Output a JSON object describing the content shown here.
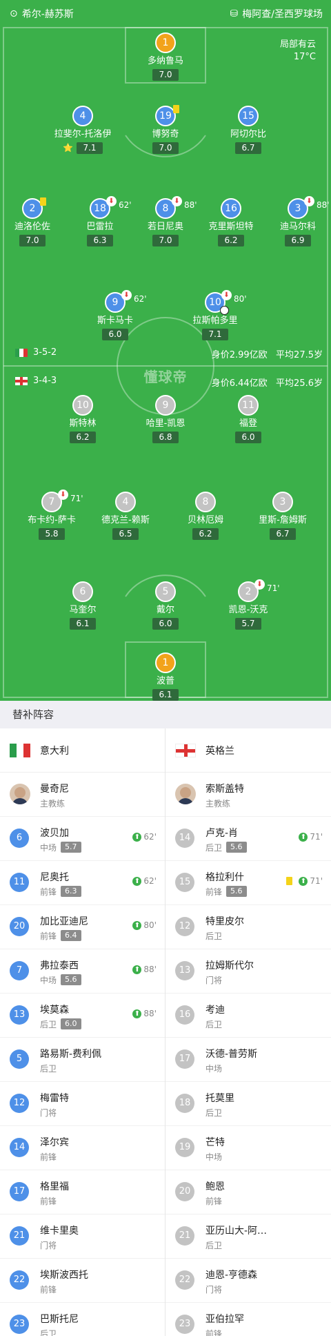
{
  "header": {
    "referee": "希尔-赫苏斯",
    "venue": "梅阿查/圣西罗球场"
  },
  "weather": {
    "condition": "局部有云",
    "temp": "17°C"
  },
  "logo": "懂球帝",
  "italy": {
    "formation": "3-5-2",
    "value": "身价2.99亿欧",
    "age": "平均27.5岁"
  },
  "england": {
    "formation": "3-4-3",
    "value": "身价6.44亿欧",
    "age": "平均25.6岁"
  },
  "pitch_players": [
    {
      "num": "1",
      "name": "多纳鲁马",
      "rating": "7.0",
      "team": "gk"
    },
    {
      "num": "4",
      "name": "拉斐尔-托洛伊",
      "rating": "7.1",
      "team": "ita",
      "star": "⭐"
    },
    {
      "num": "19",
      "name": "博努奇",
      "rating": "7.0",
      "team": "ita"
    },
    {
      "num": "15",
      "name": "阿切尔比",
      "rating": "6.7",
      "team": "ita"
    },
    {
      "num": "2",
      "name": "迪洛伦佐",
      "rating": "7.0",
      "team": "ita"
    },
    {
      "num": "18",
      "name": "巴雷拉",
      "rating": "6.3",
      "team": "ita",
      "sub": "62'"
    },
    {
      "num": "8",
      "name": "若日尼奥",
      "rating": "7.0",
      "team": "ita",
      "sub": "88'"
    },
    {
      "num": "16",
      "name": "克里斯坦特",
      "rating": "6.2",
      "team": "ita"
    },
    {
      "num": "3",
      "name": "迪马尔科",
      "rating": "6.9",
      "team": "ita",
      "sub": "88'"
    },
    {
      "num": "9",
      "name": "斯卡马卡",
      "rating": "6.0",
      "team": "ita",
      "sub": "62'"
    },
    {
      "num": "10",
      "name": "拉斯帕多里",
      "rating": "7.1",
      "team": "ita",
      "sub": "80'"
    },
    {
      "num": "10",
      "name": "斯特林",
      "rating": "6.2",
      "team": "eng"
    },
    {
      "num": "9",
      "name": "哈里-凯恩",
      "rating": "6.8",
      "team": "eng"
    },
    {
      "num": "11",
      "name": "福登",
      "rating": "6.0",
      "team": "eng"
    },
    {
      "num": "7",
      "name": "布卡约-萨卡",
      "rating": "5.8",
      "team": "eng",
      "sub": "71'"
    },
    {
      "num": "4",
      "name": "德克兰-赖斯",
      "rating": "6.5",
      "team": "eng"
    },
    {
      "num": "8",
      "name": "贝林厄姆",
      "rating": "6.2",
      "team": "eng"
    },
    {
      "num": "3",
      "name": "里斯-詹姆斯",
      "rating": "6.7",
      "team": "eng"
    },
    {
      "num": "6",
      "name": "马奎尔",
      "rating": "6.1",
      "team": "eng"
    },
    {
      "num": "5",
      "name": "戴尔",
      "rating": "6.0",
      "team": "eng"
    },
    {
      "num": "2",
      "name": "凯恩-沃克",
      "rating": "5.7",
      "team": "eng",
      "sub": "71'"
    },
    {
      "num": "1",
      "name": "波普",
      "rating": "6.1",
      "team": "gk"
    }
  ],
  "subs": {
    "title": "替补阵容",
    "italy": {
      "team": "意大利",
      "coach": {
        "name": "曼奇尼",
        "role": "主教练"
      },
      "players": [
        {
          "num": "6",
          "name": "波贝加",
          "pos": "中场",
          "rating": "5.7",
          "in": "62'"
        },
        {
          "num": "11",
          "name": "尼奥托",
          "pos": "前锋",
          "rating": "6.3",
          "in": "62'"
        },
        {
          "num": "20",
          "name": "加比亚迪尼",
          "pos": "前锋",
          "rating": "6.4",
          "in": "80'"
        },
        {
          "num": "7",
          "name": "弗拉泰西",
          "pos": "中场",
          "rating": "5.6",
          "in": "88'"
        },
        {
          "num": "13",
          "name": "埃莫森",
          "pos": "后卫",
          "rating": "6.0",
          "in": "88'"
        },
        {
          "num": "5",
          "name": "路易斯-费利佩",
          "pos": "后卫"
        },
        {
          "num": "12",
          "name": "梅雷特",
          "pos": "门将"
        },
        {
          "num": "14",
          "name": "泽尔宾",
          "pos": "前锋"
        },
        {
          "num": "17",
          "name": "格里福",
          "pos": "前锋"
        },
        {
          "num": "21",
          "name": "维卡里奥",
          "pos": "门将"
        },
        {
          "num": "22",
          "name": "埃斯波西托",
          "pos": "前锋"
        },
        {
          "num": "23",
          "name": "巴斯托尼",
          "pos": "后卫"
        }
      ]
    },
    "england": {
      "team": "英格兰",
      "coach": {
        "name": "索斯盖特",
        "role": "主教练"
      },
      "players": [
        {
          "num": "14",
          "name": "卢克-肖",
          "pos": "后卫",
          "rating": "5.6",
          "in": "71'"
        },
        {
          "num": "15",
          "name": "格拉利什",
          "pos": "前锋",
          "rating": "5.6",
          "in": "71'",
          "yc": true
        },
        {
          "num": "12",
          "name": "特里皮尔",
          "pos": "后卫"
        },
        {
          "num": "13",
          "name": "拉姆斯代尔",
          "pos": "门将"
        },
        {
          "num": "16",
          "name": "考迪",
          "pos": "后卫"
        },
        {
          "num": "17",
          "name": "沃德-普劳斯",
          "pos": "中场"
        },
        {
          "num": "18",
          "name": "托莫里",
          "pos": "后卫"
        },
        {
          "num": "19",
          "name": "芒特",
          "pos": "中场"
        },
        {
          "num": "20",
          "name": "鲍恩",
          "pos": "前锋"
        },
        {
          "num": "21",
          "name": "亚历山大-阿…",
          "pos": "后卫"
        },
        {
          "num": "22",
          "name": "迪恩-亨德森",
          "pos": "门将"
        },
        {
          "num": "23",
          "name": "亚伯拉罕",
          "pos": "前锋"
        }
      ]
    }
  },
  "colors": {
    "pitch": "#3bb04a",
    "italy": "#4e90e8",
    "england": "#c3c3c3",
    "gk": "#f2a31b"
  }
}
